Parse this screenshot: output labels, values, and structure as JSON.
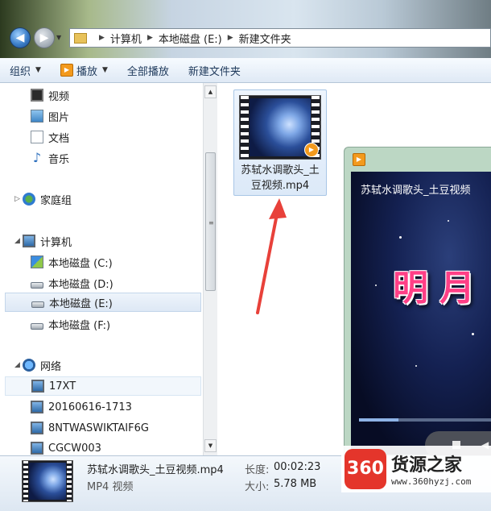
{
  "address": {
    "segments": [
      "计算机",
      "本地磁盘 (E:)",
      "新建文件夹"
    ]
  },
  "toolbar": {
    "organize": "组织",
    "play": "播放",
    "play_all": "全部播放",
    "new_folder": "新建文件夹"
  },
  "nav": {
    "libraries": [
      "视频",
      "图片",
      "文档",
      "音乐"
    ],
    "homegroup": "家庭组",
    "computer": "计算机",
    "drives": [
      "本地磁盘 (C:)",
      "本地磁盘 (D:)",
      "本地磁盘 (E:)",
      "本地磁盘 (F:)"
    ],
    "network": "网络",
    "network_items": [
      "17XT",
      "20160616-1713",
      "8NTWASWIKTAIF6G",
      "CGCW003"
    ]
  },
  "file": {
    "name_line1": "苏轼水调歌头_土",
    "name_line2": "豆视频.mp4"
  },
  "player": {
    "video_title": "苏轼水调歌头_土豆视频",
    "big_text": "明月",
    "progress": 0.3
  },
  "details": {
    "name": "苏轼水调歌头_土豆视频.mp4",
    "type": "MP4 视频",
    "length_label": "长度:",
    "length_value": "00:02:23",
    "size_label": "大小:",
    "size_value": "5.78 MB"
  },
  "watermark": {
    "logo": "360",
    "name": "货源之家",
    "url": "www.360hyzj.com"
  },
  "colors": {
    "accent_orange": "#f39a1d",
    "selection_blue": "#dde8f5",
    "arrow_red": "#e8413a"
  }
}
